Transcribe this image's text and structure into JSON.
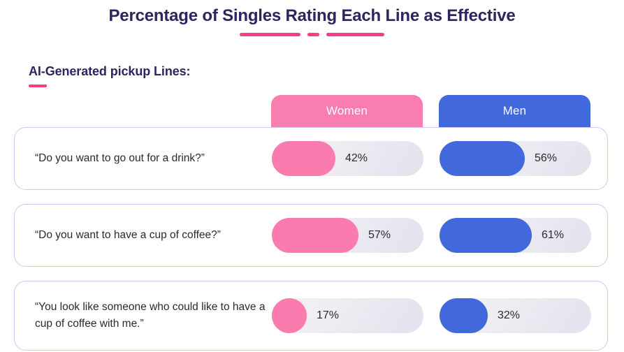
{
  "header": {
    "title": "Percentage of Singles Rating Each Line as Effective",
    "subtitle": "AI-Generated pickup Lines:"
  },
  "colors": {
    "title": "#2B2560",
    "accent_pink": "#FB3B85",
    "women": "#F97DB0",
    "men": "#4269DC",
    "card_border": "#CFC9F0",
    "track": "#ECECF2"
  },
  "columns": [
    {
      "label": "Women",
      "key": "women"
    },
    {
      "label": "Men",
      "key": "men"
    }
  ],
  "rows": [
    {
      "label": "“Do you want to go out for a drink?”",
      "women": {
        "value": 42,
        "display": "42%"
      },
      "men": {
        "value": 56,
        "display": "56%"
      }
    },
    {
      "label": "“Do you want to have a cup of coffee?”",
      "women": {
        "value": 57,
        "display": "57%"
      },
      "men": {
        "value": 61,
        "display": "61%"
      }
    },
    {
      "label": "“You look like someone who could like to have a cup of coffee with me.”",
      "women": {
        "value": 17,
        "display": "17%"
      },
      "men": {
        "value": 32,
        "display": "32%"
      }
    }
  ],
  "chart_data": {
    "type": "bar",
    "title": "Percentage of Singles Rating Each Line as Effective",
    "subtitle": "AI-Generated pickup Lines:",
    "orientation": "horizontal",
    "categories": [
      "“Do you want to go out for a drink?”",
      "“Do you want to have a cup of coffee?”",
      "“You look like someone who could like to have a cup of coffee with me.”"
    ],
    "series": [
      {
        "name": "Women",
        "values": [
          42,
          57,
          17
        ],
        "color": "#FA7BAE"
      },
      {
        "name": "Men",
        "values": [
          56,
          61,
          32
        ],
        "color": "#4269DC"
      }
    ],
    "xlabel": "",
    "ylabel": "",
    "xlim": [
      0,
      100
    ],
    "unit": "%",
    "grid": false,
    "legend": "top"
  }
}
